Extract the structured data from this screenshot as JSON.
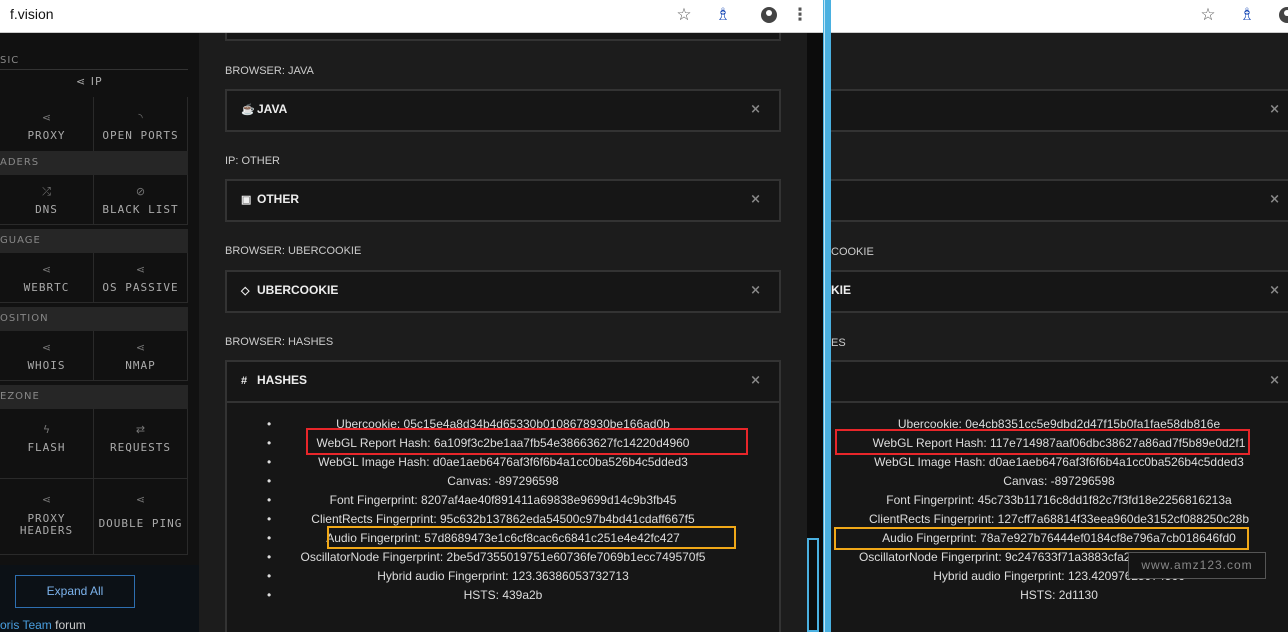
{
  "left_window": {
    "address": "f.vision",
    "icons": [
      "star-icon",
      "extension-icon",
      "account-icon",
      "more-icon"
    ],
    "sidebar": {
      "cut_label": "SIC",
      "ip_label": "IP",
      "cells": [
        {
          "label": "PROXY",
          "icon": "share-icon"
        },
        {
          "label": "OPEN PORTS",
          "icon": "rss-icon"
        },
        {
          "label": "DNS",
          "icon": "shuffle-icon"
        },
        {
          "label": "BLACK LIST",
          "icon": "block-icon"
        },
        {
          "label": "WEBRTC",
          "icon": "share-icon"
        },
        {
          "label": "OS PASSIVE",
          "icon": "share-icon"
        },
        {
          "label": "WHOIS",
          "icon": "share-icon"
        },
        {
          "label": "NMAP",
          "icon": "share-icon"
        },
        {
          "label": "FLASH",
          "icon": "bolt-icon"
        },
        {
          "label": "REQUESTS",
          "icon": "swap-icon"
        },
        {
          "label": "PROXY",
          "label2": "HEADERS",
          "icon": "share-icon"
        },
        {
          "label": "DOUBLE PING",
          "icon": "share-icon"
        }
      ],
      "bands": [
        "ADERS",
        "GUAGE",
        "OSITION",
        "EZONE"
      ],
      "expand_all": "Expand All",
      "forum_link": "oris Team",
      "forum_text": " forum"
    },
    "sections": [
      {
        "label": "BROWSER: JAVA",
        "title": "JAVA",
        "icon": "coffee-icon"
      },
      {
        "label": "IP: OTHER",
        "title": "OTHER",
        "icon": "briefcase-icon"
      },
      {
        "label": "BROWSER: UBERCOOKIE",
        "title": "UBERCOOKIE",
        "icon": "code-icon"
      },
      {
        "label": "BROWSER: HASHES",
        "title": "HASHES",
        "icon": "hash-icon"
      }
    ],
    "close_glyph": "×",
    "hashes": [
      "Ubercookie: 05c15e4a8d34b4d65330b0108678930be166ad0b",
      "WebGL Report Hash: 6a109f3c2be1aa7fb54e38663627fc14220d4960",
      "WebGL Image Hash: d0ae1aeb6476af3f6f6b4a1cc0ba526b4c5dded3",
      "Canvas: -897296598",
      "Font Fingerprint: 8207af4ae40f891411a69838e9699d14c9b3fb45",
      "ClientRects Fingerprint: 95c632b137862eda54500c97b4bd41cdaff667f5",
      "Audio Fingerprint: 57d8689473e1c6cf8cac6c6841c251e4e42fc427",
      "OscillatorNode Fingerprint: 2be5d7355019751e60736fe7069b1ecc749570f5",
      "Hybrid audio Fingerprint: 123.36386053732713",
      "HSTS: 439a2b"
    ]
  },
  "right_window": {
    "cut_labels": [
      "COOKIE",
      "KIE",
      "ES"
    ],
    "hashes": [
      "Ubercookie: 0e4cb8351cc5e9dbd2d47f15b0fa1fae58db816e",
      "WebGL Report Hash: 117e714987aaf06dbc38627a86ad7f5b89e0d2f1",
      "WebGL Image Hash: d0ae1aeb6476af3f6f6b4a1cc0ba526b4c5dded3",
      "Canvas: -897296598",
      "Font Fingerprint: 45c733b11716c8dd1f82c7f3fd18e2256816213a",
      "ClientRects Fingerprint: 127cff7a68814f33eea960de3152cf088250c28b",
      "Audio Fingerprint: 78a7e927b76444ef0184cf8e796a7cb018646fd0",
      "OscillatorNode Fingerprint: 9c247633f71a3883cfa22c91177e3a8fe1a24d74",
      "Hybrid audio Fingerprint: 123.42097625974566",
      "HSTS: 2d1130"
    ],
    "watermark": "www.amz123.com"
  },
  "colors": {
    "highlight_red": "#e8262a",
    "highlight_yellow": "#f0a818",
    "divider": "#4ab0e0"
  }
}
